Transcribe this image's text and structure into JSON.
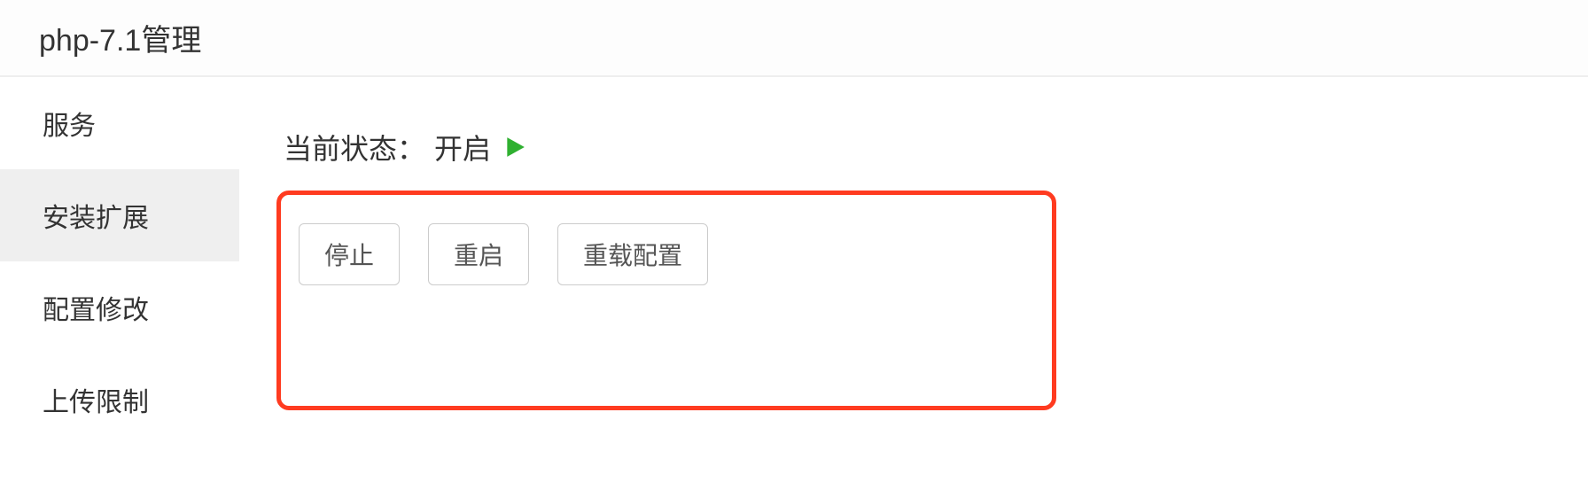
{
  "header": {
    "title": "php-7.1管理"
  },
  "sidebar": {
    "items": [
      {
        "label": "服务",
        "active": false
      },
      {
        "label": "安装扩展",
        "active": true
      },
      {
        "label": "配置修改",
        "active": false
      },
      {
        "label": "上传限制",
        "active": false
      }
    ]
  },
  "main": {
    "status_label": "当前状态：",
    "status_value": "开启",
    "buttons": {
      "stop": "停止",
      "restart": "重启",
      "reload": "重载配置"
    }
  },
  "colors": {
    "play_icon": "#2fb030",
    "highlight_border": "#ff3b20"
  }
}
